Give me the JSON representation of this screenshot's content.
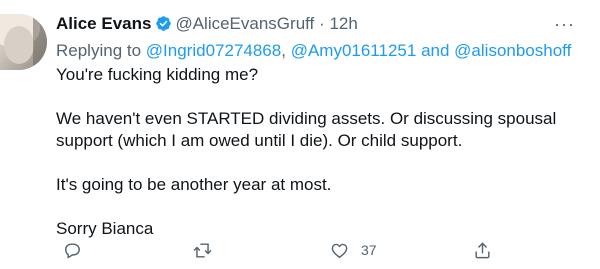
{
  "tweet": {
    "author_name": "Alice Evans",
    "handle": "@AliceEvansGruff",
    "separator": "·",
    "time": "12h",
    "more_label": "···",
    "reply_prefix": "Replying to",
    "reply_mention_1": "@Ingrid07274868",
    "reply_sep": ",",
    "reply_mention_2": "@Amy01611251",
    "reply_and": "and",
    "reply_mention_3": "@alisonboshoff",
    "lines": [
      "You're fucking kidding me?",
      "We haven't even STARTED dividing assets. Or discussing spousal support (which I am owed until I die). Or child support.",
      "It's going to be another year at most.",
      "Sorry Bianca"
    ],
    "actions": {
      "like_count": "37"
    },
    "icons": [
      "verified-icon",
      "more-icon",
      "reply-icon",
      "retweet-icon",
      "like-icon",
      "share-icon"
    ],
    "colors": {
      "accent": "#1d9bf0",
      "secondary_text": "#536471",
      "primary_text": "#0f1419"
    }
  }
}
